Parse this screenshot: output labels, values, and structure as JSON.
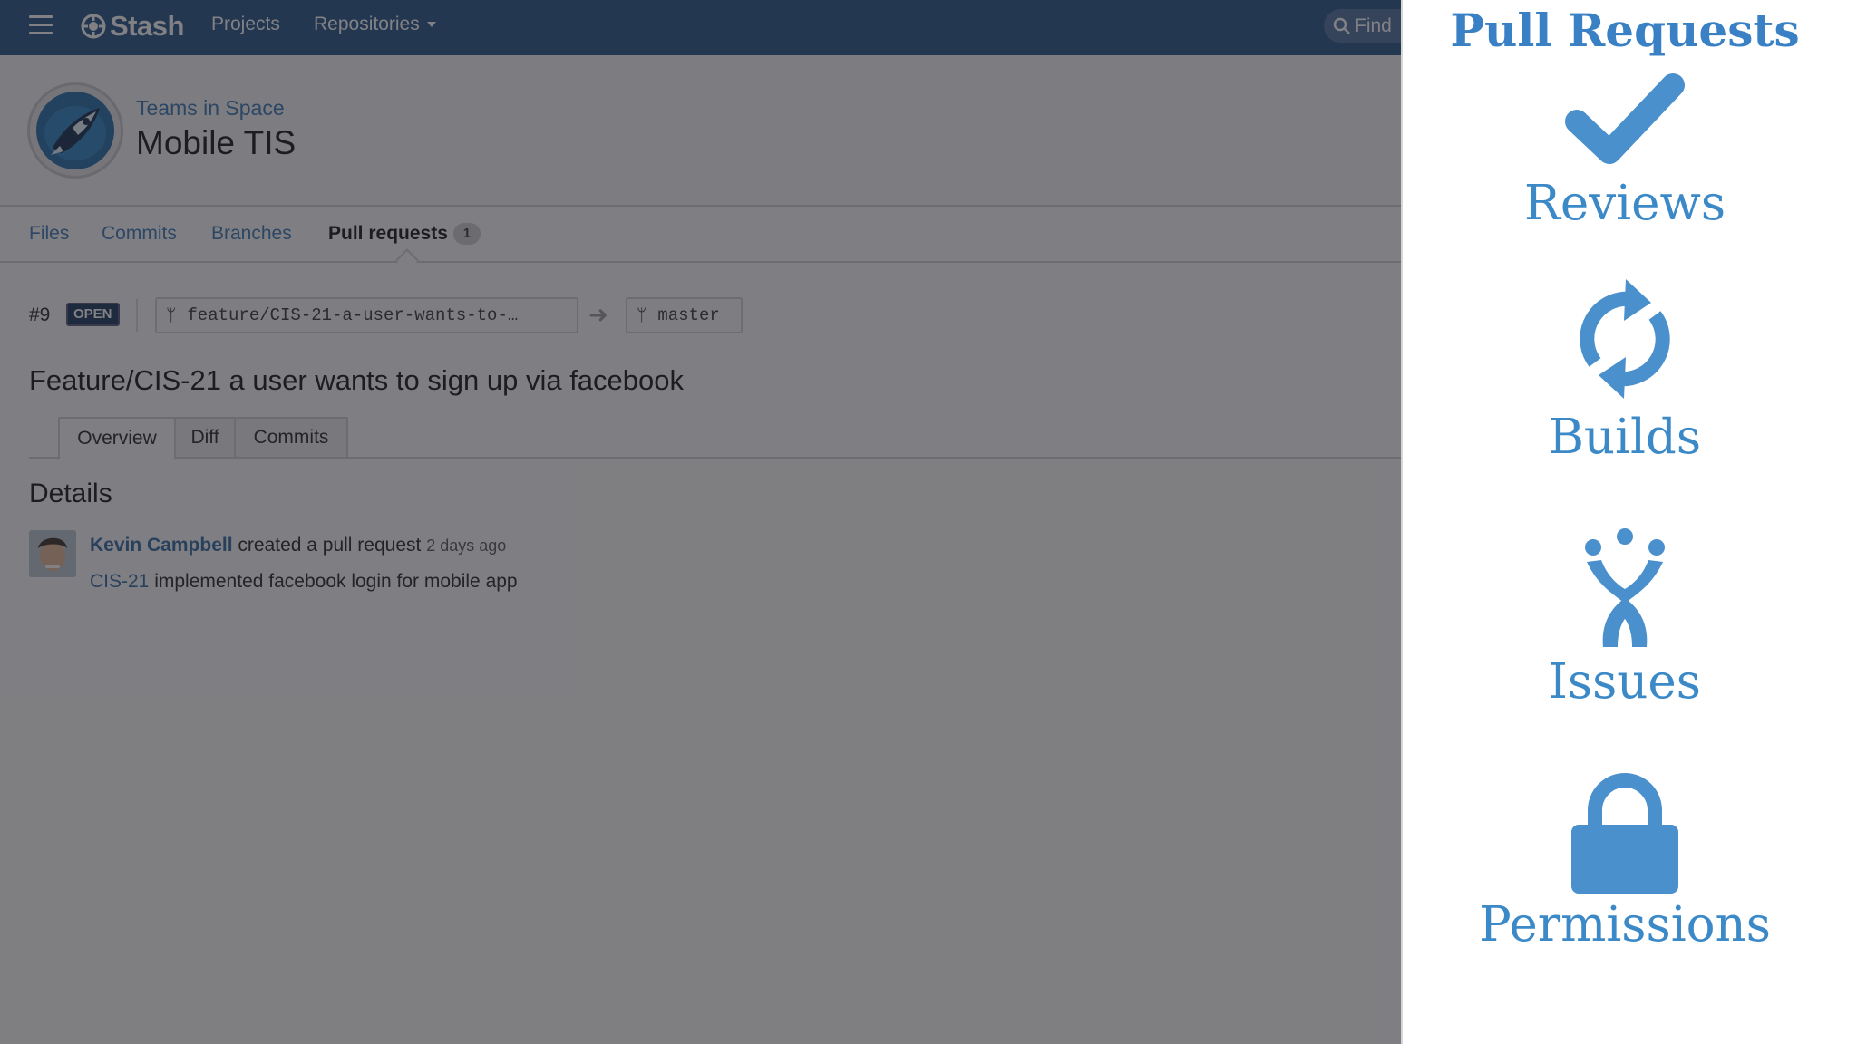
{
  "topbar": {
    "brand": "Stash",
    "nav": [
      {
        "label": "Projects"
      },
      {
        "label": "Repositories"
      }
    ],
    "search_placeholder": "Find"
  },
  "repo": {
    "project": "Teams in Space",
    "name": "Mobile TIS",
    "tabs": [
      {
        "label": "Files"
      },
      {
        "label": "Commits"
      },
      {
        "label": "Branches"
      },
      {
        "label": "Pull requests",
        "count": "1"
      }
    ]
  },
  "pull_request": {
    "id": "#9",
    "status": "OPEN",
    "source_branch": "feature/CIS-21-a-user-wants-to-…",
    "target_branch": "master",
    "title": "Feature/CIS-21 a user wants to sign up via facebook",
    "tabs": [
      {
        "label": "Overview"
      },
      {
        "label": "Diff"
      },
      {
        "label": "Commits"
      }
    ],
    "details_heading": "Details",
    "activity": {
      "user": "Kevin Campbell",
      "action": "created a pull request",
      "time": "2 days ago",
      "issue_key": "CIS-21",
      "message": "implemented facebook login for mobile app"
    }
  },
  "panel": {
    "title": "Pull Requests",
    "accent_color": "#4a90cd",
    "features": [
      {
        "label": "Reviews",
        "icon": "checkmark-icon"
      },
      {
        "label": "Builds",
        "icon": "refresh-icon"
      },
      {
        "label": "Issues",
        "icon": "jira-icon"
      },
      {
        "label": "Permissions",
        "icon": "lock-icon"
      }
    ]
  }
}
